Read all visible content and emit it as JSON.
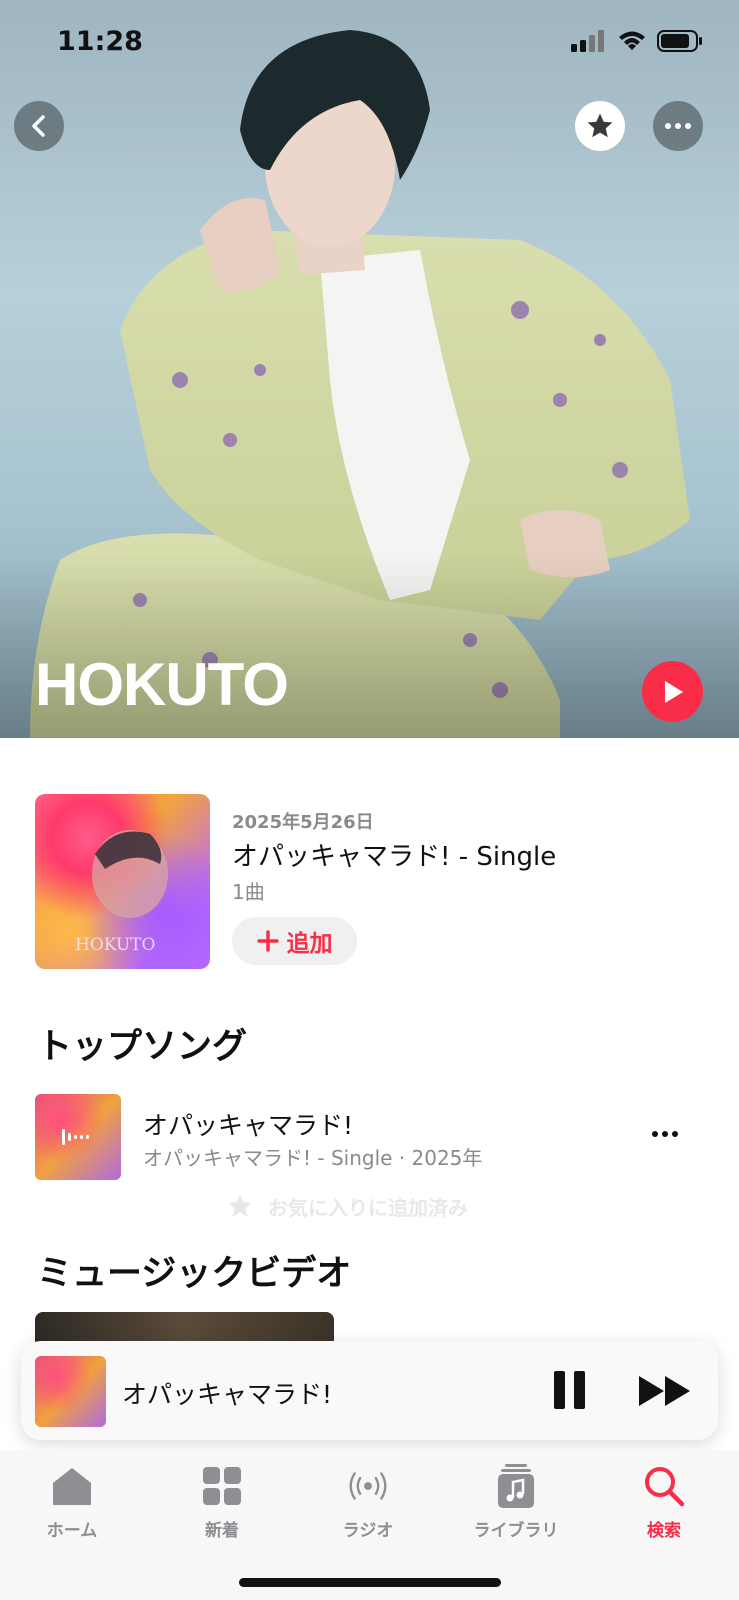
{
  "status_bar": {
    "time": "11:28"
  },
  "artist": {
    "name": "HOKUTO"
  },
  "latest_release": {
    "date": "2025年5月26日",
    "title": "オパッキャマラド! - Single",
    "count": "1曲",
    "add_label": "追加",
    "art_text": "HOKUTO"
  },
  "sections": {
    "top_songs": "トップソング",
    "music_videos": "ミュージックビデオ"
  },
  "top_songs": [
    {
      "title": "オパッキャマラド!",
      "subtitle": "オパッキャマラド! - Single · 2025年"
    }
  ],
  "toast": {
    "text": "お気に入りに追加済み"
  },
  "now_playing": {
    "title": "オパッキャマラド!"
  },
  "tabs": [
    {
      "label": "ホーム",
      "icon": "home-icon"
    },
    {
      "label": "新着",
      "icon": "grid-icon"
    },
    {
      "label": "ラジオ",
      "icon": "radio-icon"
    },
    {
      "label": "ライブラリ",
      "icon": "library-icon"
    },
    {
      "label": "検索",
      "icon": "search-icon",
      "active": true
    }
  ],
  "colors": {
    "accent": "#fa2d48",
    "secondary_text": "#8a8a8e"
  }
}
